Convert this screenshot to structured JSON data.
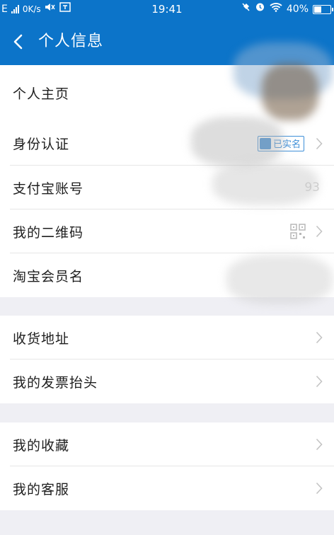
{
  "status_bar": {
    "network_type": "E",
    "speed": "0K/s",
    "time": "19:41",
    "battery_percent": "40%",
    "battery_level": 0.4
  },
  "header": {
    "title": "个人信息"
  },
  "group1": [
    {
      "label": "个人主页"
    },
    {
      "label": "身份认证",
      "badge": "已实名"
    },
    {
      "label": "支付宝账号",
      "value": "93"
    },
    {
      "label": "我的二维码"
    },
    {
      "label": "淘宝会员名"
    }
  ],
  "group2": [
    {
      "label": "收货地址"
    },
    {
      "label": "我的发票抬头"
    }
  ],
  "group3": [
    {
      "label": "我的收藏"
    },
    {
      "label": "我的客服"
    }
  ],
  "colors": {
    "brand_blue": "#0c74c9",
    "background": "#efeff4",
    "badge_blue": "#3e8fd8"
  }
}
